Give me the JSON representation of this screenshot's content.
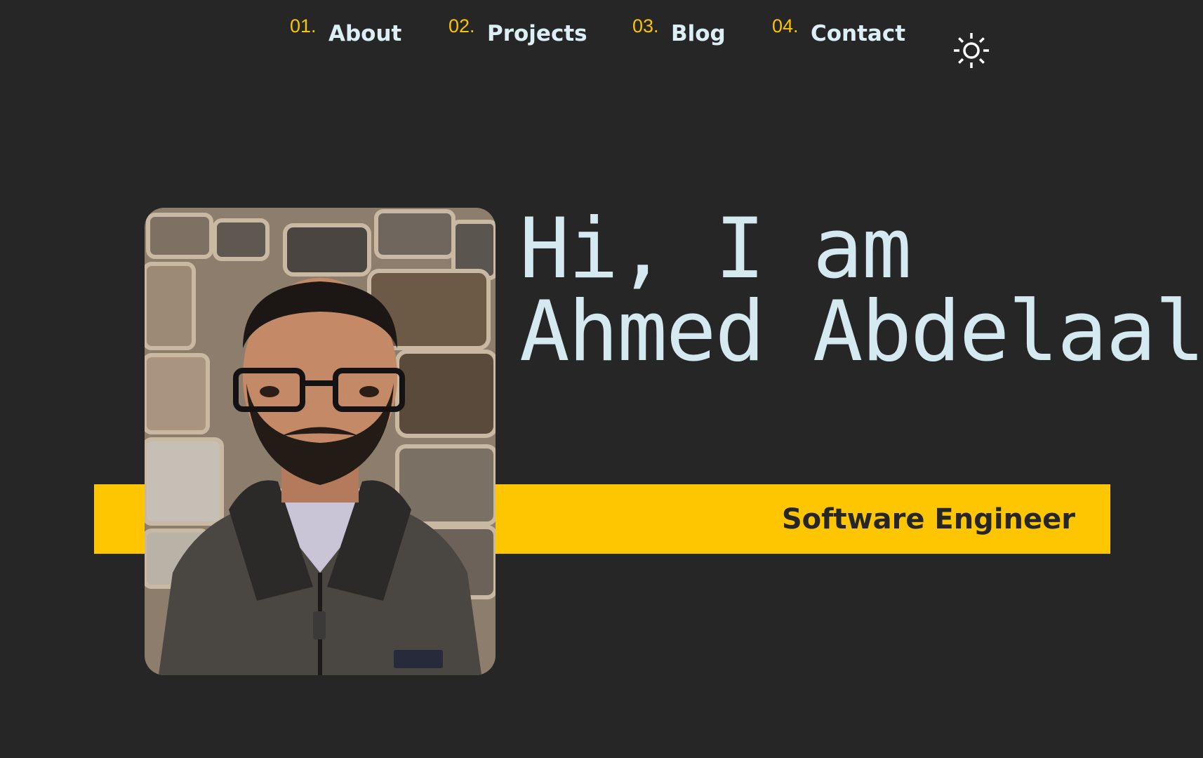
{
  "nav": {
    "items": [
      {
        "number": "01.",
        "label": "About"
      },
      {
        "number": "02.",
        "label": "Projects"
      },
      {
        "number": "03.",
        "label": "Blog"
      },
      {
        "number": "04.",
        "label": "Contact"
      }
    ]
  },
  "theme_toggle": {
    "icon": "sun-icon"
  },
  "hero": {
    "greeting_line1": "Hi, I am",
    "name": "Ahmed Abdelaal",
    "role": "Software Engineer"
  },
  "colors": {
    "background": "#262626",
    "accent": "#fdc601",
    "text": "#d4eaf0"
  }
}
